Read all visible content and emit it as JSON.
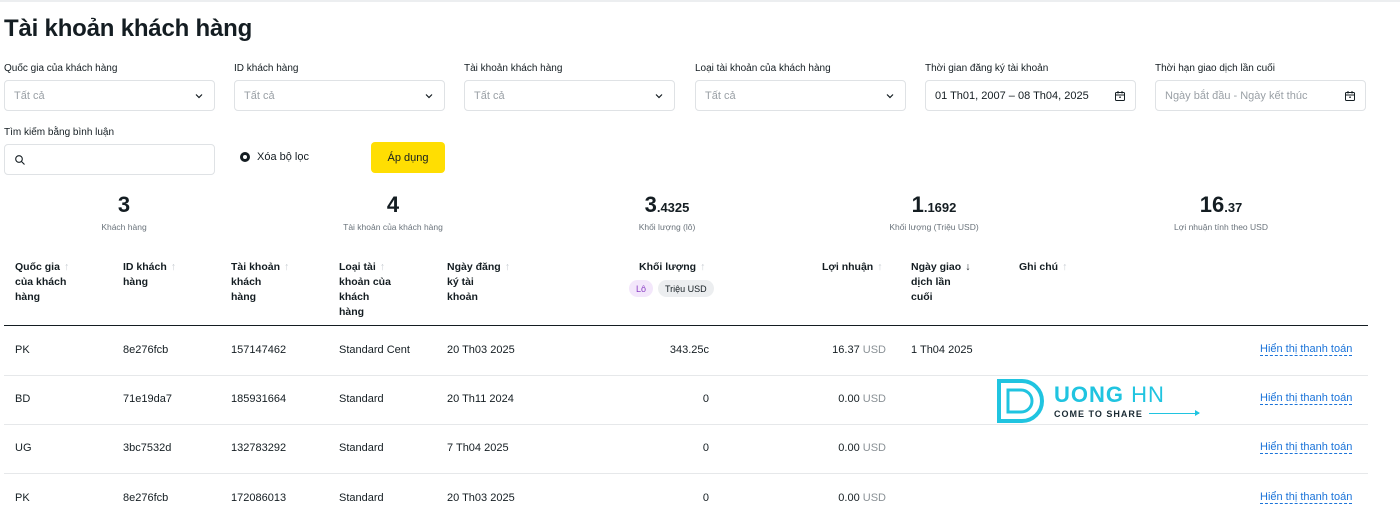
{
  "page": {
    "title": "Tài khoản khách hàng"
  },
  "filters": {
    "country": {
      "label": "Quốc gia của khách hàng",
      "placeholder": "Tất cả"
    },
    "client_id": {
      "label": "ID khách hàng",
      "placeholder": "Tất cả"
    },
    "client_account": {
      "label": "Tài khoản khách hàng",
      "placeholder": "Tất cả"
    },
    "account_type": {
      "label": "Loại tài khoản của khách hàng",
      "placeholder": "Tất cả"
    },
    "reg_date": {
      "label": "Thời gian đăng ký tài khoản",
      "value": "01 Th01, 2007 – 08 Th04, 2025"
    },
    "last_trade": {
      "label": "Thời hạn giao dịch lần cuối",
      "placeholder": "Ngày bắt đầu - Ngày kết thúc"
    },
    "comment_search": {
      "label": "Tìm kiếm bằng bình luận",
      "value": ""
    },
    "clear_label": "Xóa bộ lọc",
    "apply_label": "Áp dụng"
  },
  "stats": [
    {
      "value": "3",
      "frac": "",
      "label": "Khách hàng"
    },
    {
      "value": "4",
      "frac": "",
      "label": "Tài khoản của khách hàng"
    },
    {
      "value": "3",
      "frac": ".4325",
      "label": "Khối lượng (lô)"
    },
    {
      "value": "1",
      "frac": ".1692",
      "label": "Khối lượng (Triệu USD)"
    },
    {
      "value": "16",
      "frac": ".37",
      "label": "Lợi nhuận tính theo USD"
    }
  ],
  "table": {
    "headers": {
      "country": [
        "Quốc gia",
        "của khách",
        "hàng"
      ],
      "client_id": [
        "ID khách",
        "hàng"
      ],
      "account": [
        "Tài khoản",
        "khách",
        "hàng"
      ],
      "type": [
        "Loại tài",
        "khoản của",
        "khách",
        "hàng"
      ],
      "reg_date": [
        "Ngày đăng",
        "ký tài",
        "khoản"
      ],
      "volume": "Khối lượng",
      "profit": "Lợi nhuận",
      "last_trade": [
        "Ngày giao",
        "dịch lần",
        "cuối"
      ],
      "comment": "Ghi chú"
    },
    "volume_pills": [
      "Lô",
      "Triệu USD"
    ],
    "rows": [
      {
        "country": "PK",
        "client_id": "8e276fcb",
        "account": "157147462",
        "type": "Standard Cent",
        "reg_date": "20 Th03 2025",
        "volume": "343.25c",
        "profit": "16.37",
        "currency": "USD",
        "last_trade": "1 Th04 2025",
        "action": "Hiển thị thanh toán"
      },
      {
        "country": "BD",
        "client_id": "71e19da7",
        "account": "185931664",
        "type": "Standard",
        "reg_date": "20 Th11 2024",
        "volume": "0",
        "profit": "0.00",
        "currency": "USD",
        "last_trade": "",
        "action": "Hiển thị thanh toán"
      },
      {
        "country": "UG",
        "client_id": "3bc7532d",
        "account": "132783292",
        "type": "Standard",
        "reg_date": "7 Th04 2025",
        "volume": "0",
        "profit": "0.00",
        "currency": "USD",
        "last_trade": "",
        "action": "Hiển thị thanh toán"
      },
      {
        "country": "PK",
        "client_id": "8e276fcb",
        "account": "172086013",
        "type": "Standard",
        "reg_date": "20 Th03 2025",
        "volume": "0",
        "profit": "0.00",
        "currency": "USD",
        "last_trade": "",
        "action": "Hiển thị thanh toán"
      }
    ]
  },
  "watermark": {
    "brand_a": "UONG",
    "brand_b": "HN",
    "tagline": "COME TO SHARE"
  },
  "colors": {
    "accent": "#ffde02",
    "link": "#1a73d9",
    "watermark": "#20c4e0"
  }
}
